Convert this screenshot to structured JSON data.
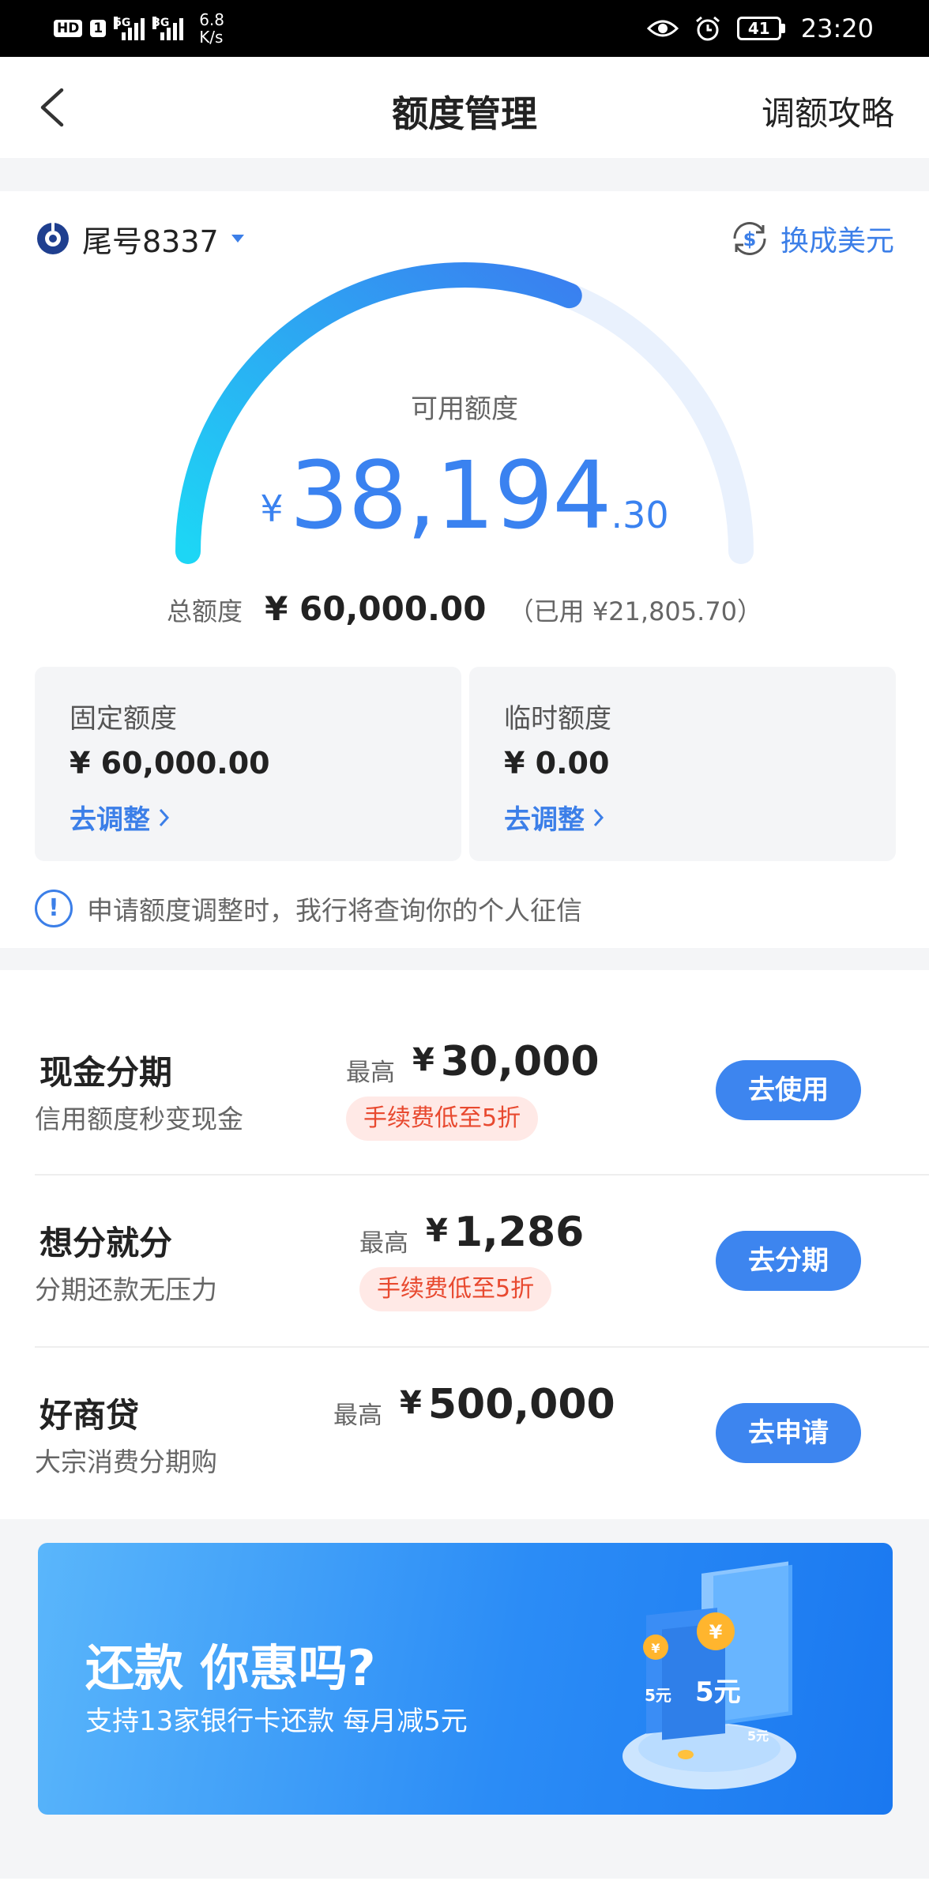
{
  "status_bar": {
    "hd": "HD",
    "sim1": "1",
    "net1": "5G",
    "net2": "3G",
    "speed_value": "6.8",
    "speed_unit": "K/s",
    "battery": "41",
    "time": "23:20"
  },
  "header": {
    "title": "额度管理",
    "strategy_link": "调额攻略"
  },
  "card": {
    "card_tail": "尾号8337",
    "currency_switch": "换成美元",
    "available_label": "可用额度",
    "available_currency": "¥",
    "available_integer": "38,194",
    "available_decimal": ".30",
    "used_fraction": 0.3634,
    "total_label": "总额度",
    "total_amount": "¥ 60,000.00",
    "used_text": "（已用 ¥21,805.70）",
    "fixed": {
      "title": "固定额度",
      "amount": "¥ 60,000.00",
      "link": "去调整"
    },
    "temporary": {
      "title": "临时额度",
      "amount": "¥ 0.00",
      "link": "去调整"
    },
    "notice": "申请额度调整时，我行将查询你的个人征信"
  },
  "products": [
    {
      "name": "现金分期",
      "subtitle": "信用额度秒变现金",
      "max_label": "最高",
      "currency": "¥",
      "amount": "30,000",
      "tag": "手续费低至5折",
      "button": "去使用"
    },
    {
      "name": "想分就分",
      "subtitle": "分期还款无压力",
      "max_label": "最高",
      "currency": "¥",
      "amount": "1,286",
      "tag": "手续费低至5折",
      "button": "去分期"
    },
    {
      "name": "好商贷",
      "subtitle": "大宗消费分期购",
      "max_label": "最高",
      "currency": "¥",
      "amount": "500,000",
      "tag": "",
      "button": "去申请"
    }
  ],
  "banner": {
    "title": "还款 你惠吗?",
    "subtitle": "支持13家银行卡还款 每月减5元",
    "art_text_1": "5元",
    "art_text_2": "5元",
    "art_text_3": "5元"
  },
  "colors": {
    "accent": "#3c7fe8",
    "gauge_start": "#1dd6f5",
    "gauge_end": "#3a7ff0",
    "gauge_track": "#e9f1fd",
    "tag_bg": "#ffe9e6",
    "tag_text": "#e8492f"
  }
}
